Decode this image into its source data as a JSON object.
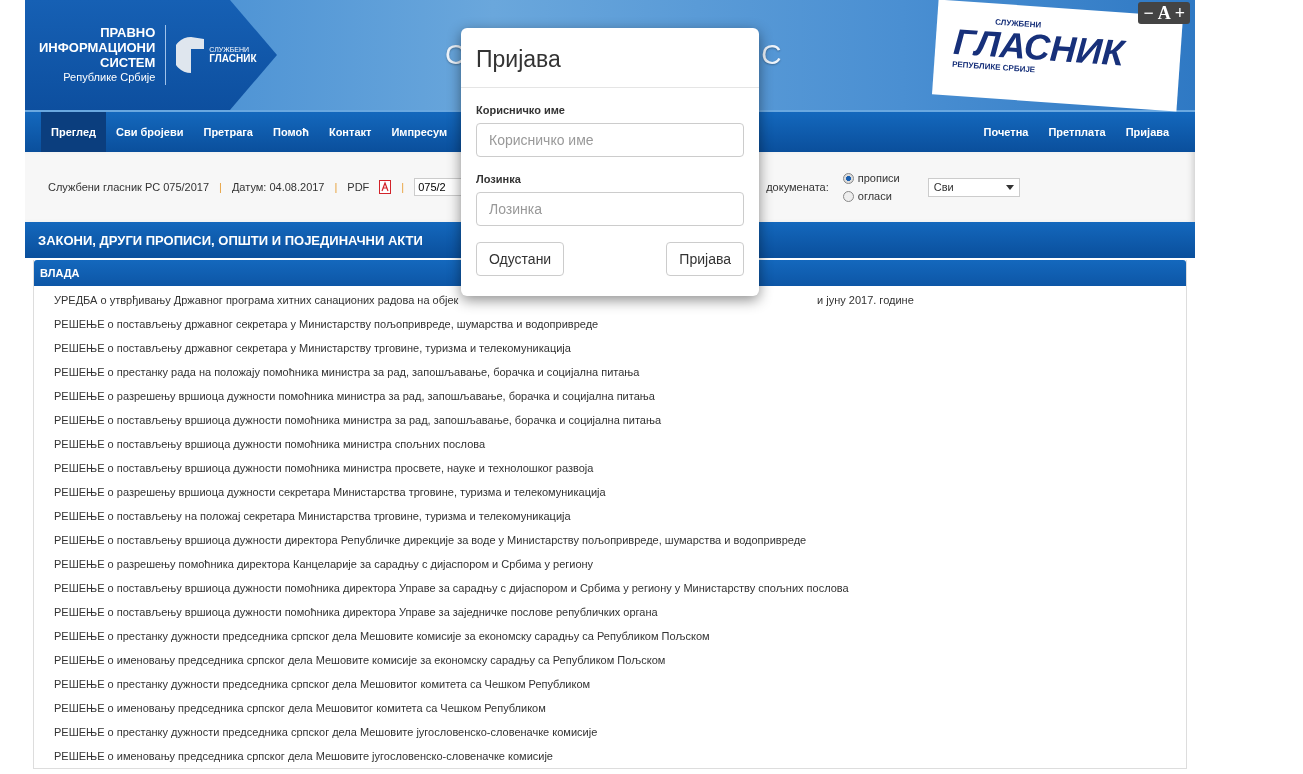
{
  "header": {
    "system_name": [
      "ПРАВНО",
      "ИНФОРМАЦИОНИ",
      "СИСТЕМ"
    ],
    "system_subtitle": "Републике Србије",
    "logo_small": "СЛУЖБЕНИ",
    "logo_name": "ГЛАСНИК",
    "title_parts": [
      "С",
      "С"
    ],
    "paper_kicker": "СЛУЖБЕНИ",
    "paper_name": "ГЛАСНИК",
    "paper_subtitle": "РЕПУБЛИКЕ СРБИЈЕ",
    "font_controls": [
      "−",
      "A",
      "+"
    ]
  },
  "nav": {
    "left": [
      {
        "label": "Преглед",
        "selected": true
      },
      {
        "label": "Сви бројеви",
        "selected": false
      },
      {
        "label": "Претрага",
        "selected": false
      },
      {
        "label": "Помоћ",
        "selected": false
      },
      {
        "label": "Контакт",
        "selected": false
      },
      {
        "label": "Импресум",
        "selected": false
      }
    ],
    "right": [
      {
        "label": "Почетна",
        "selected": false
      },
      {
        "label": "Претплата",
        "selected": false
      },
      {
        "label": "Пријава",
        "selected": false
      }
    ]
  },
  "toolbar": {
    "issue": "Службени гласник РС 075/2017",
    "date": "Датум: 04.08.2017",
    "pdf_label": "PDF",
    "separators": [
      "|",
      "|",
      "|"
    ],
    "issue_field": "075/2",
    "doc_type_label": "докумената:",
    "doc_types": [
      {
        "label": "прописи",
        "selected": true
      },
      {
        "label": "огласи",
        "selected": false
      }
    ],
    "filter": "Сви"
  },
  "section_title": "ЗАКОНИ, ДРУГИ ПРОПИСИ, ОПШТИ И ПОЈЕДИНАЧНИ АКТИ",
  "group": {
    "title": "ВЛАДА",
    "items": [
      {
        "text": "УРЕДБА о утврђивању Државног програма хитних санационих радова на објек",
        "text_end": "и јуну 2017. године"
      },
      {
        "text": "РЕШЕЊЕ о постављењу државног секретара у Министарству пољопривреде, шумарства и водопривреде"
      },
      {
        "text": "РЕШЕЊЕ о постављењу државног секретара у Министарству трговине, туризма и телекомуникација"
      },
      {
        "text": "РЕШЕЊЕ о престанку рада на положају помоћника министра за рад, запошљавање, борачка и социјална питања"
      },
      {
        "text": "РЕШЕЊЕ о разрешењу вршиоца дужности помоћника министра за рад, запошљавање, борачка и социјална питања"
      },
      {
        "text": "РЕШЕЊЕ о постављењу вршиоца дужности помоћника министра за рад, запошљавање, борачка и социјална питања"
      },
      {
        "text": "РЕШЕЊЕ о постављењу вршиоца дужности помоћника министра спољних послова"
      },
      {
        "text": "РЕШЕЊЕ о постављењу вршиоца дужности помоћника министра просвете, науке и технолошког развоја"
      },
      {
        "text": "РЕШЕЊЕ о разрешењу вршиоца дужности секретара Министарства трговине, туризма и телекомуникација"
      },
      {
        "text": "РЕШЕЊЕ о постављењу на положај секретара Министарства трговине, туризма и телекомуникација"
      },
      {
        "text": "РЕШЕЊЕ о постављењу вршиоца дужности директора Републичке дирекције за воде у Министарству пољопривреде, шумарства и водопривреде"
      },
      {
        "text": "РЕШЕЊЕ о разрешењу помоћника директора Канцеларије за сарадњу с дијаспором и Србима у региону"
      },
      {
        "text": "РЕШЕЊЕ о постављењу вршиоца дужности помоћника директора Управе за сарадњу с дијаспором и Србима у региону у Министарству спољних послова"
      },
      {
        "text": "РЕШЕЊЕ о постављењу вршиоца дужности помоћника директора Управе за заједничке послове републичких органа"
      },
      {
        "text": "РЕШЕЊЕ о престанку дужности председника српског дела Мешовите комисије за економску сарадњу са Републиком Пољском"
      },
      {
        "text": "РЕШЕЊЕ о именовању председника српског дела Мешовите комисије за економску сарадњу са Републиком Пољском"
      },
      {
        "text": "РЕШЕЊЕ о престанку дужности председника српског дела Мешовитог комитета са Чешком Републиком"
      },
      {
        "text": "РЕШЕЊЕ о именовању председника српског дела Мешовитог комитета са Чешком Републиком"
      },
      {
        "text": "РЕШЕЊЕ о престанку дужности председника српског дела Мешовите југословенско-словеначке комисије"
      },
      {
        "text": "РЕШЕЊЕ о именовању председника српског дела Мешовите југословенско-словеначке комисије"
      }
    ]
  },
  "modal": {
    "title": "Пријава",
    "fields": [
      {
        "label": "Корисничко име",
        "placeholder": "Корисничко име"
      },
      {
        "label": "Лозинка",
        "placeholder": "Лозинка"
      }
    ],
    "cancel": "Одустани",
    "submit": "Пријава"
  }
}
